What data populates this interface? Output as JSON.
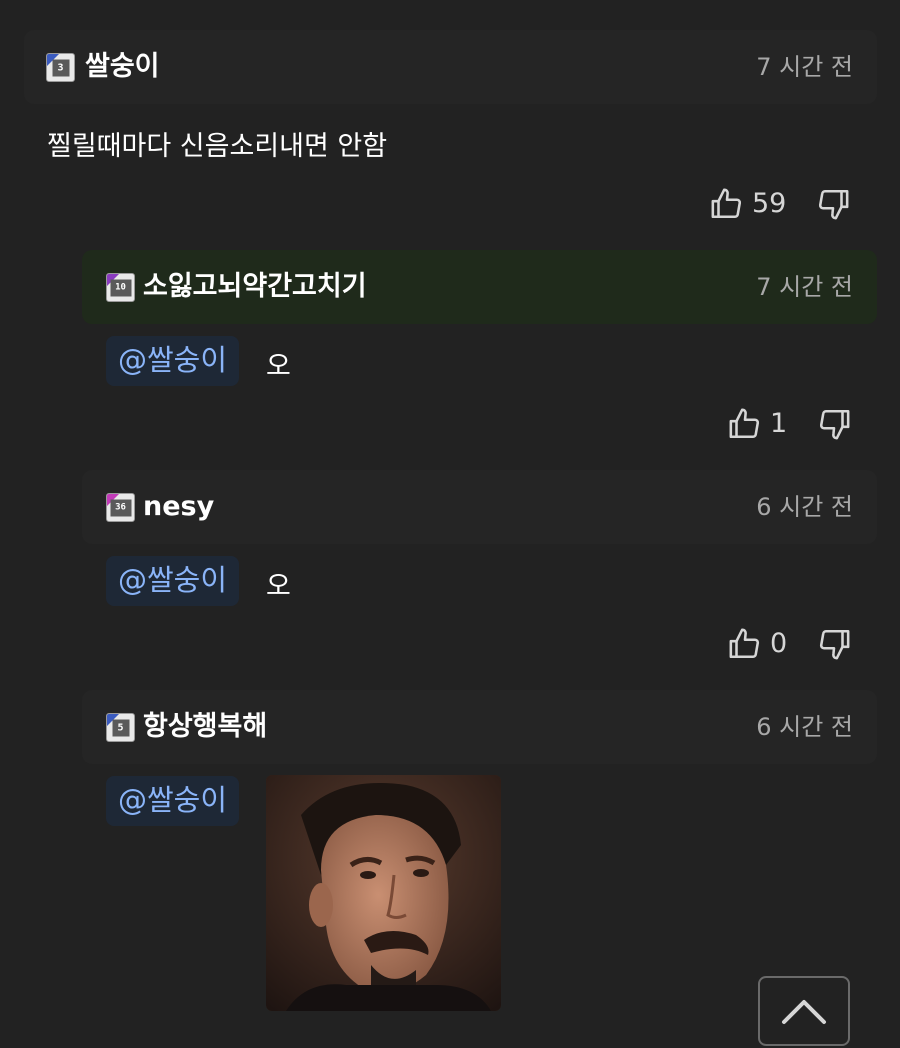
{
  "comments": [
    {
      "username": "쌀숭이",
      "level": "3",
      "time": "7 시간 전",
      "text": "찔릴때마다 신음소리내면 안함",
      "likes": "59"
    }
  ],
  "replies": [
    {
      "username": "소잃고뇌약간고치기",
      "level": "10",
      "time": "7 시간 전",
      "mention": "@쌀숭이",
      "text": "오",
      "likes": "1"
    },
    {
      "username": "nesy",
      "level": "36",
      "time": "6 시간 전",
      "mention": "@쌀숭이",
      "text": "오",
      "likes": "0"
    },
    {
      "username": "항상행복해",
      "level": "5",
      "time": "6 시간 전",
      "mention": "@쌀숭이",
      "text": ""
    }
  ],
  "colors": {
    "background": "#222222",
    "highlight_header": "#1f2a1b",
    "mention_text": "#8ab4f8",
    "time_text": "#a8a8a8"
  },
  "icons": {
    "like": "thumbs-up-icon",
    "dislike": "thumbs-down-icon",
    "scroll": "chevron-up-icon"
  }
}
